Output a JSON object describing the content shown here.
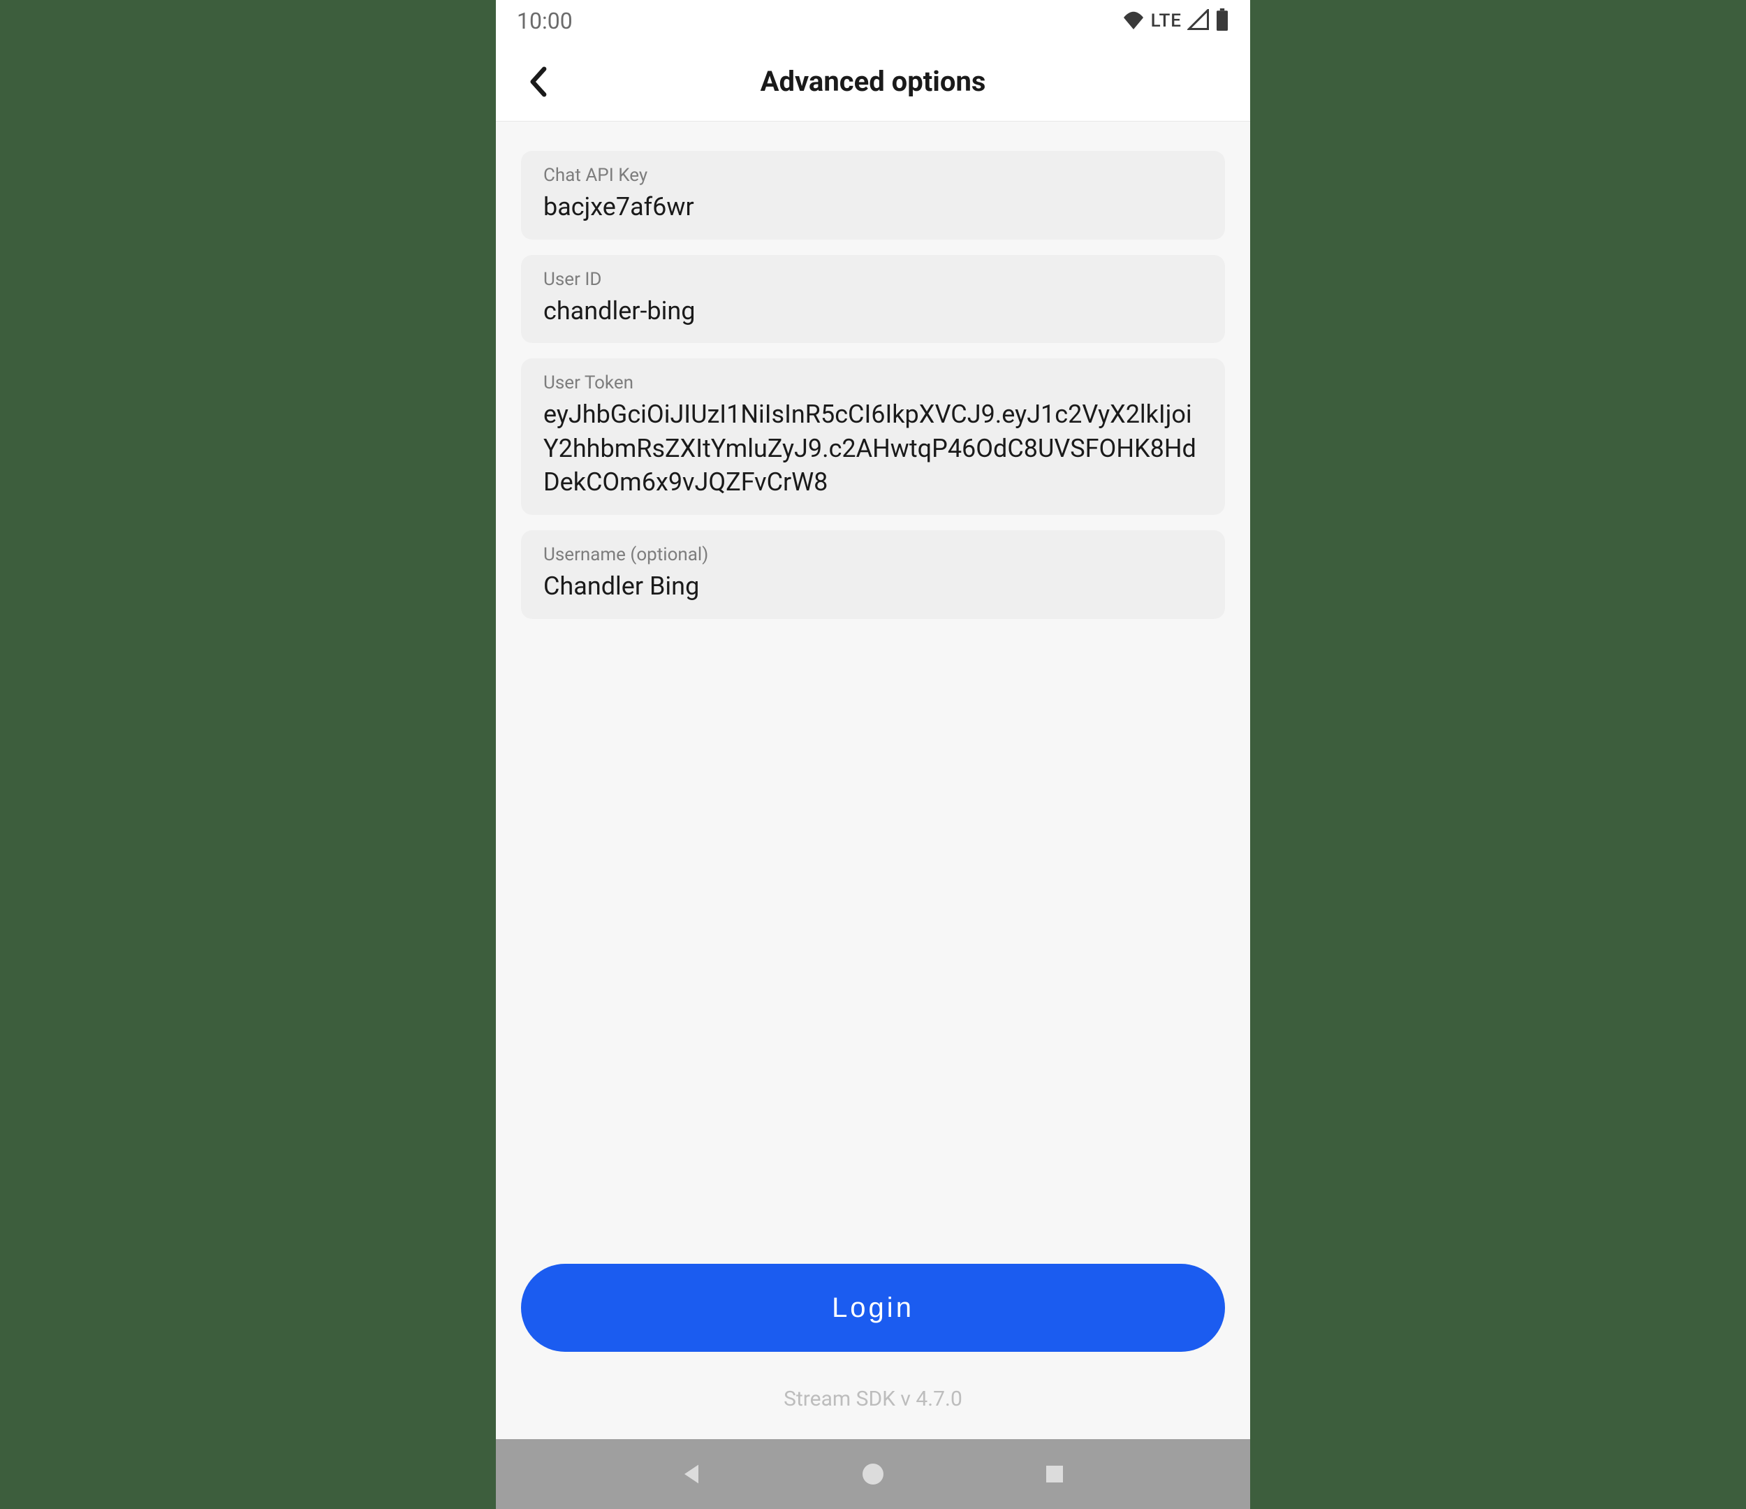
{
  "statusBar": {
    "time": "10:00",
    "lte": "LTE"
  },
  "appBar": {
    "title": "Advanced options"
  },
  "fields": {
    "apiKey": {
      "label": "Chat API Key",
      "value": "bacjxe7af6wr"
    },
    "userId": {
      "label": "User ID",
      "value": "chandler-bing"
    },
    "userToken": {
      "label": "User Token",
      "value": "eyJhbGciOiJIUzI1NiIsInR5cCI6IkpXVCJ9.eyJ1c2VyX2lkIjoiY2hhbmRsZXItYmluZyJ9.c2AHwtqP46OdC8UVSFOHK8HdDekCOm6x9vJQZFvCrW8"
    },
    "username": {
      "label": "Username (optional)",
      "value": "Chandler Bing"
    }
  },
  "loginButton": "Login",
  "sdkVersion": "Stream SDK v 4.7.0"
}
